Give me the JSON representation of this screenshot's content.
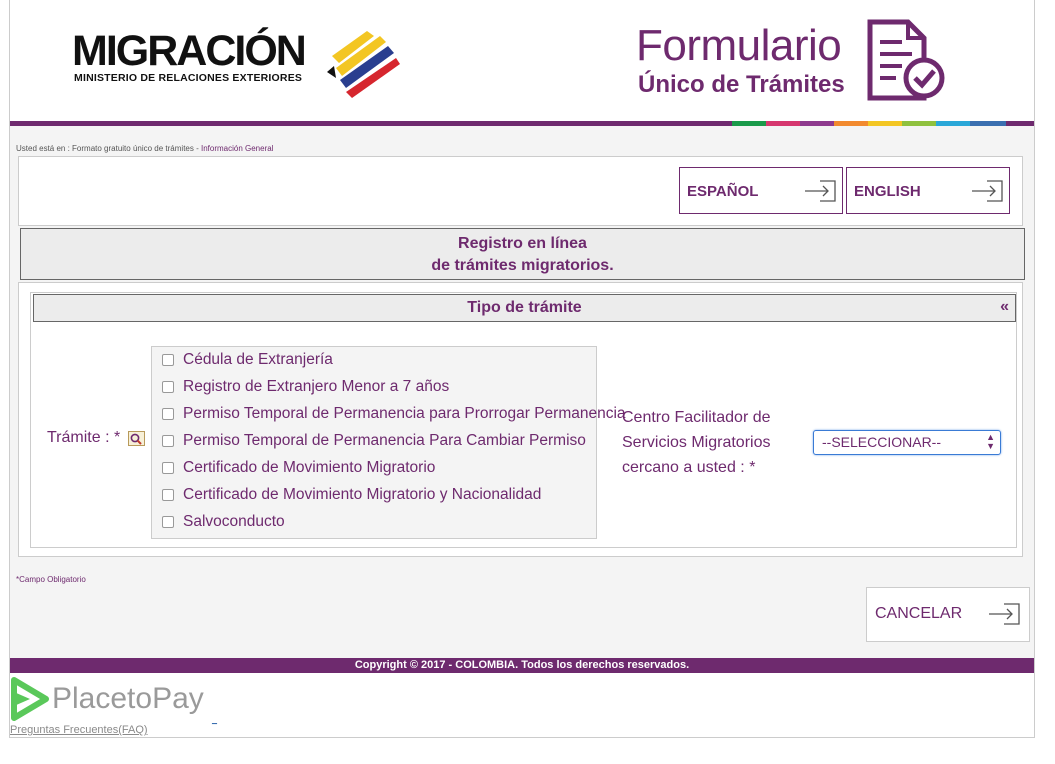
{
  "header": {
    "brand_title": "MIGRACIÓN",
    "brand_subtitle": "MINISTERIO DE RELACIONES EXTERIORES",
    "form_title_line1": "Formulario",
    "form_title_line2": "Único de Trámites"
  },
  "colors": {
    "brand_purple": "#6e2a6e",
    "strip": [
      "#1a9a4a",
      "#d6376e",
      "#8e3a8e",
      "#f28a2e",
      "#f3c623",
      "#8fc13e",
      "#2aa7d8",
      "#3a6fb0"
    ]
  },
  "breadcrumb": {
    "prefix": "Usted está en : Formato gratuito único de trámites - ",
    "current": "Información General"
  },
  "language": {
    "spanish_label": "ESPAÑOL",
    "english_label": "ENGLISH"
  },
  "registro": {
    "line1": "Registro en línea",
    "line2": "de trámites migratorios."
  },
  "tipo_tramite": {
    "title": "Tipo de trámite",
    "collapse_symbol": "«",
    "tramite_label": "Trámite : *",
    "options": [
      "Cédula de Extranjería",
      "Registro de Extranjero Menor a 7 años",
      "Permiso Temporal de Permanencia para Prorrogar Permanencia",
      "Permiso Temporal de Permanencia Para Cambiar Permiso",
      "Certificado de Movimiento Migratorio",
      "Certificado de Movimiento Migratorio y Nacionalidad",
      "Salvoconducto"
    ],
    "centro_label_line1": "Centro Facilitador de",
    "centro_label_line2": "Servicios Migratorios",
    "centro_label_line3": "cercano a usted : *",
    "select_value": "--SELECCIONAR--"
  },
  "campo_obligatorio": "*Campo Obligatorio",
  "cancel_label": "CANCELAR",
  "footer": {
    "copyright": "Copyright © 2017 - COLOMBIA. Todos los derechos reservados.",
    "ptp_brand": "PlacetoPay",
    "faq": "Preguntas Frecuentes(FAQ)"
  }
}
